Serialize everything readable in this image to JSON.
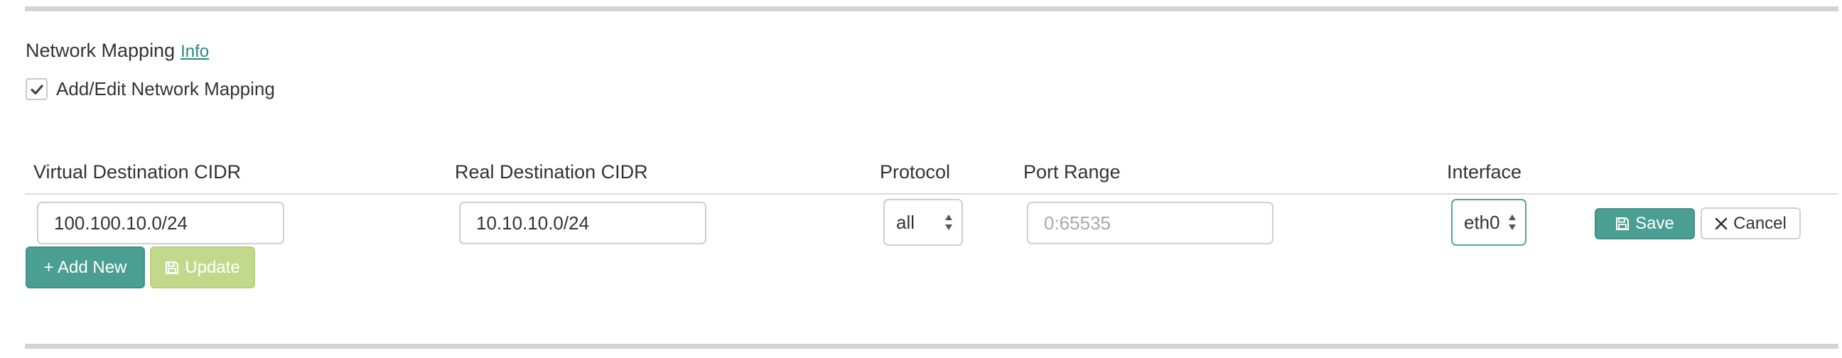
{
  "section": {
    "title": "Network Mapping",
    "info_link": "Info",
    "checkbox_label": "Add/Edit Network Mapping",
    "checkbox_checked": true
  },
  "table": {
    "headers": {
      "virtual_cidr": "Virtual Destination CIDR",
      "real_cidr": "Real Destination CIDR",
      "protocol": "Protocol",
      "port_range": "Port Range",
      "interface": "Interface"
    },
    "row": {
      "virtual_cidr": "100.100.10.0/24",
      "real_cidr": "10.10.10.0/24",
      "protocol": "all",
      "port_range_placeholder": "0:65535",
      "port_range": "",
      "interface": "eth0"
    }
  },
  "actions": {
    "save_label": "Save",
    "cancel_label": "Cancel",
    "add_new_label": "+ Add New",
    "update_label": "Update"
  },
  "icons": {
    "checkbox": "check-icon",
    "select": "sort-arrows-icon",
    "save": "floppy-disk-icon",
    "cancel": "close-icon"
  },
  "colors": {
    "primary": "#4a9e92",
    "disabled": "#c2d98b",
    "link": "#27897d",
    "focus_border": "#4ea89c"
  }
}
